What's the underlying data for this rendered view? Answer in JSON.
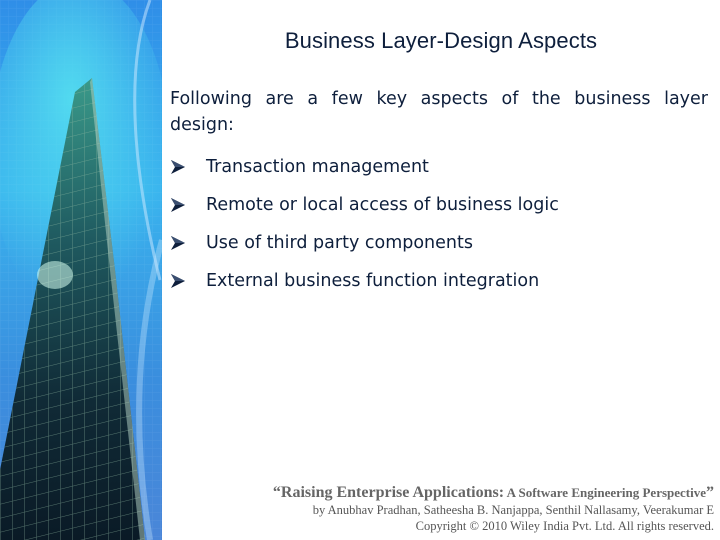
{
  "slide": {
    "title": "Business Layer-Design Aspects",
    "intro_line1": "Following are a few key aspects of the business layer",
    "intro_line2": "design:",
    "bullet_icon": "arrow-bullet-icon",
    "bullets": [
      "Transaction management",
      "Remote or local access of business logic",
      "Use of third party components",
      "External business function integration"
    ]
  },
  "footer": {
    "open_quote": "“",
    "book_title": "Raising Enterprise Applications:",
    "book_subtitle": " A Software Engineering Perspective",
    "close_quote": "”",
    "authors": "by Anubhav Pradhan, Satheesha B. Nanjappa, Senthil Nallasamy, Veerakumar E",
    "copyright": "Copyright © 2010 Wiley India Pvt. Ltd.  All rights reserved."
  },
  "colors": {
    "text": "#0e1f3c",
    "footer_text": "#555555"
  }
}
